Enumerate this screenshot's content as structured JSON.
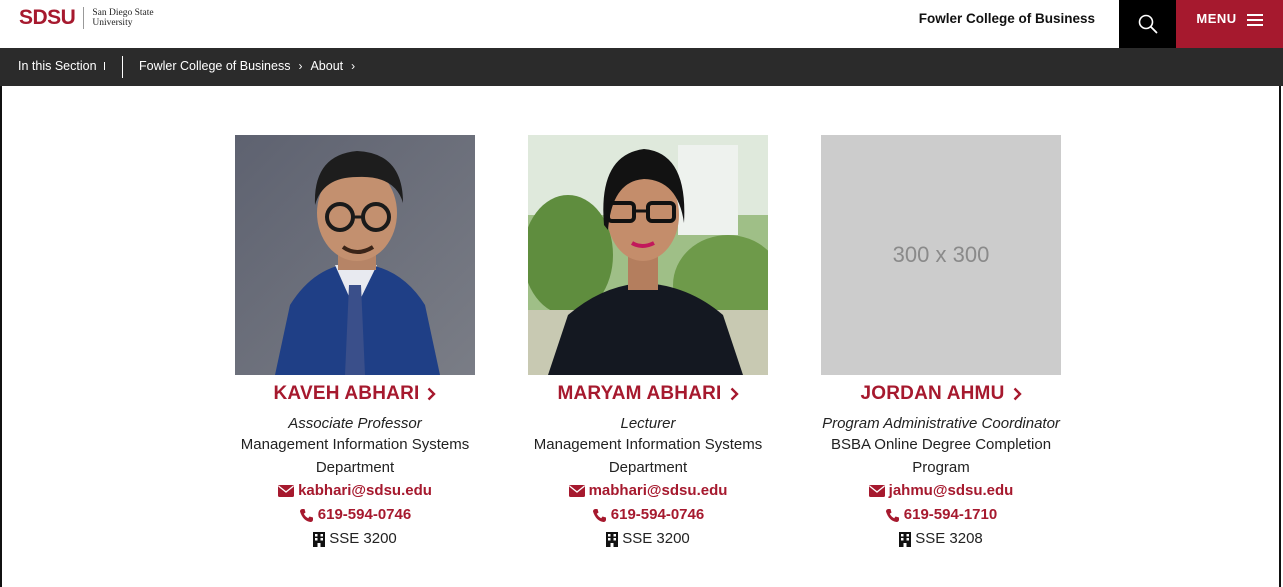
{
  "header": {
    "logo_text": "SDSU",
    "logo_subtitle_line1": "San Diego State",
    "logo_subtitle_line2": "University",
    "college_title": "Fowler College of Business",
    "menu_label": "MENU"
  },
  "subnav": {
    "section_label": "In this Section",
    "breadcrumbs": [
      "Fowler College of Business",
      "About"
    ]
  },
  "people": [
    {
      "name": "KAVEH ABHARI",
      "title": "Associate Professor",
      "department_line1": "Management Information Systems",
      "department_line2": "Department",
      "email": "kabhari@sdsu.edu",
      "phone": "619-594-0746",
      "office": "SSE 3200"
    },
    {
      "name": "MARYAM ABHARI",
      "title": "Lecturer",
      "department_line1": "Management Information Systems",
      "department_line2": "Department",
      "email": "mabhari@sdsu.edu",
      "phone": "619-594-0746",
      "office": "SSE 3200"
    },
    {
      "name": "JORDAN AHMU",
      "title": "Program Administrative Coordinator",
      "department_line1": "BSBA Online Degree Completion",
      "department_line2": "Program",
      "email": "jahmu@sdsu.edu",
      "phone": "619-594-1710",
      "office": "SSE 3208",
      "placeholder_text": "300 x 300"
    }
  ],
  "colors": {
    "brand_red": "#a6192e",
    "subnav_bg": "#2b2b2b",
    "placeholder_bg": "#cccccc"
  },
  "icons": [
    "search-icon",
    "hamburger-icon",
    "chevron-right-icon",
    "envelope-icon",
    "phone-icon",
    "building-icon"
  ]
}
